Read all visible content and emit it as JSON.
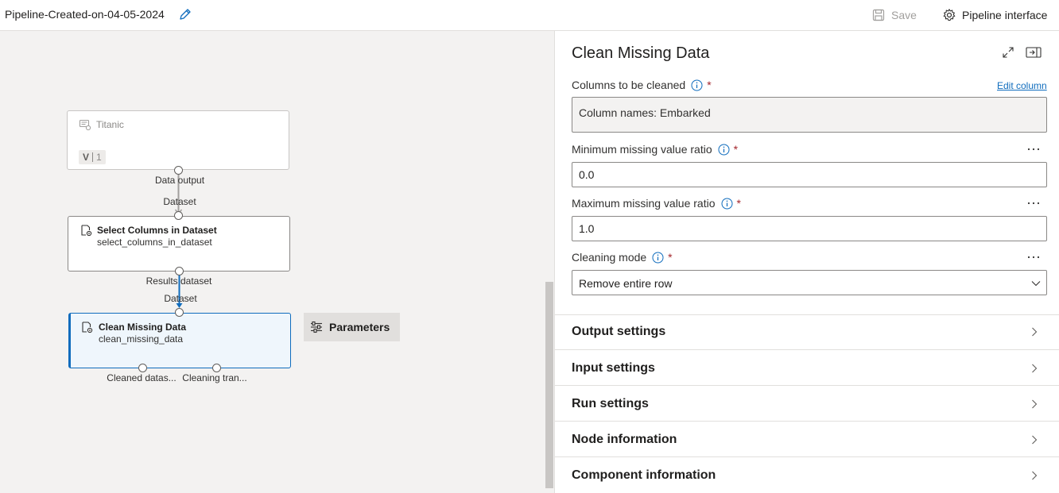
{
  "header": {
    "pipeline_name": "Pipeline-Created-on-04-05-2024",
    "save_label": "Save",
    "pipeline_interface_label": "Pipeline interface"
  },
  "canvas": {
    "nodes": [
      {
        "title": "Titanic",
        "version_prefix": "V",
        "version_number": "1"
      },
      {
        "title": "Select Columns in Dataset",
        "subtitle": "select_columns_in_dataset"
      },
      {
        "title": "Clean Missing Data",
        "subtitle": "clean_missing_data"
      }
    ],
    "port_labels": {
      "titanic_out": "Data output",
      "select_in": "Dataset",
      "select_out": "Results dataset",
      "clean_in": "Dataset",
      "clean_out_1": "Cleaned datas...",
      "clean_out_2": "Cleaning tran..."
    },
    "parameters_button": "Parameters"
  },
  "panel": {
    "title": "Clean Missing Data",
    "columns": {
      "label": "Columns to be cleaned",
      "edit_link": "Edit column",
      "value": "Column names: Embarked"
    },
    "min_ratio": {
      "label": "Minimum missing value ratio",
      "value": "0.0"
    },
    "max_ratio": {
      "label": "Maximum missing value ratio",
      "value": "1.0"
    },
    "cleaning_mode": {
      "label": "Cleaning mode",
      "value": "Remove entire row"
    },
    "required_mark": "*",
    "sections": [
      "Output settings",
      "Input settings",
      "Run settings",
      "Node information",
      "Component information"
    ]
  },
  "colors": {
    "accent": "#0f6cbd",
    "canvas_bg": "#f3f2f1",
    "required": "#a4262c"
  }
}
